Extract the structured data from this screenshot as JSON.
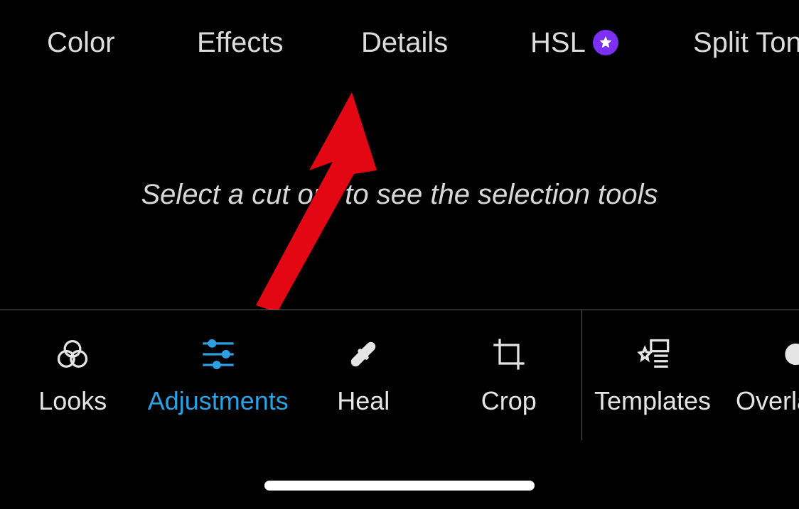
{
  "top_tabs": {
    "color": {
      "label": "Color"
    },
    "effects": {
      "label": "Effects"
    },
    "details": {
      "label": "Details"
    },
    "hsl": {
      "label": "HSL",
      "badge": "star"
    },
    "split_tone": {
      "label": "Split Tone"
    }
  },
  "canvas": {
    "placeholder": "Select a cut out to see the selection tools"
  },
  "toolbar": {
    "looks": {
      "label": "Looks"
    },
    "adjustments": {
      "label": "Adjustments",
      "active": true
    },
    "heal": {
      "label": "Heal"
    },
    "crop": {
      "label": "Crop"
    },
    "templates": {
      "label": "Templates"
    },
    "overlays": {
      "label": "Overlays"
    }
  },
  "annotation": {
    "arrow_color": "#e30613"
  }
}
